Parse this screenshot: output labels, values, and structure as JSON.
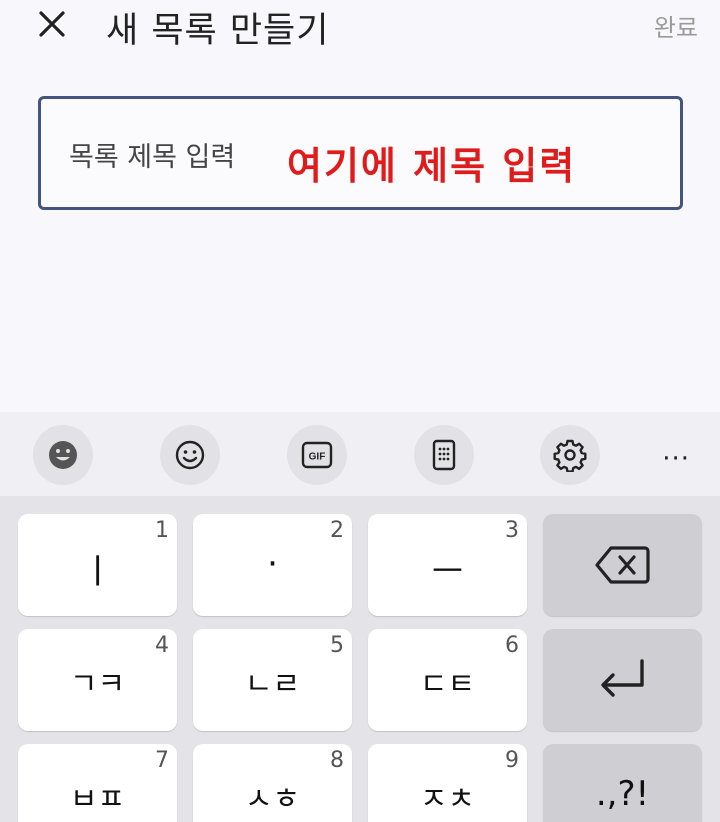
{
  "header": {
    "title": "새 목록 만들기",
    "done_label": "완료"
  },
  "input": {
    "label": "목록 제목 입력",
    "overlay_note": "여기에 제목 입력"
  },
  "toolbar": {
    "items": [
      "emoji-face-icon",
      "smiley-icon",
      "gif-icon",
      "keypad-icon",
      "gear-icon"
    ],
    "more_label": "···"
  },
  "keyboard": {
    "keys": [
      {
        "num": "1",
        "glyph": "ㅣ"
      },
      {
        "num": "2",
        "glyph": "·"
      },
      {
        "num": "3",
        "glyph": "ㅡ"
      },
      {
        "num": "4",
        "glyph": "ㄱㅋ"
      },
      {
        "num": "5",
        "glyph": "ㄴㄹ"
      },
      {
        "num": "6",
        "glyph": "ㄷㅌ"
      },
      {
        "num": "7",
        "glyph": "ㅂㅍ"
      },
      {
        "num": "8",
        "glyph": "ㅅㅎ"
      },
      {
        "num": "9",
        "glyph": "ㅈㅊ"
      }
    ],
    "punct_label": ".,?!",
    "colors": {
      "key": "#ffffff",
      "special_key": "#cfcfd3",
      "accent_border": "#44547c"
    }
  }
}
